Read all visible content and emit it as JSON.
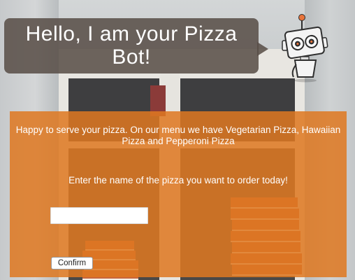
{
  "header": {
    "bubble_text": "Hello, I am your Pizza Bot!"
  },
  "mascot": {
    "icon": "robot-icon",
    "antenna_color": "#e8743b",
    "eye_color": "#e8743b"
  },
  "form": {
    "intro": "Happy to serve your pizza. On our menu we have Vegetarian Pizza, Hawaiian Pizza and Pepperoni Pizza",
    "prompt": "Enter the name of the pizza you want to order today!",
    "input_value": "",
    "input_placeholder": "",
    "confirm_label": "Confirm"
  },
  "colors": {
    "panel_orange": "#de7821",
    "bubble_gray": "#574d46",
    "text_white": "#ffffff"
  }
}
